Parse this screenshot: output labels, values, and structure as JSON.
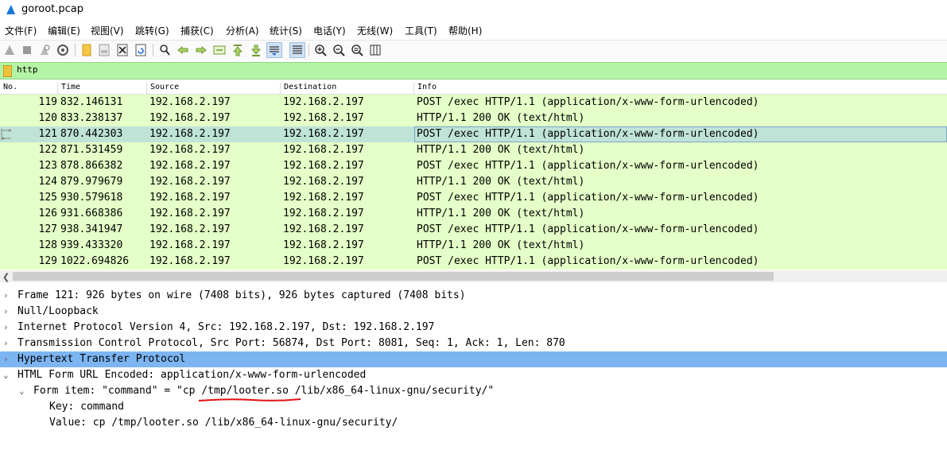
{
  "window": {
    "title": "goroot.pcap"
  },
  "menu": [
    "文件(F)",
    "编辑(E)",
    "视图(V)",
    "跳转(G)",
    "捕获(C)",
    "分析(A)",
    "统计(S)",
    "电话(Y)",
    "无线(W)",
    "工具(T)",
    "帮助(H)"
  ],
  "filter": {
    "value": "http"
  },
  "columns": [
    "No.",
    "Time",
    "Source",
    "Destination",
    "Info"
  ],
  "packets": [
    {
      "no": "119",
      "time": "832.146131",
      "src": "192.168.2.197",
      "dst": "192.168.2.197",
      "info": "POST /exec HTTP/1.1  (application/x-www-form-urlencoded)"
    },
    {
      "no": "120",
      "time": "833.238137",
      "src": "192.168.2.197",
      "dst": "192.168.2.197",
      "info": "HTTP/1.1 200 OK  (text/html)"
    },
    {
      "no": "121",
      "time": "870.442303",
      "src": "192.168.2.197",
      "dst": "192.168.2.197",
      "info": "POST /exec HTTP/1.1  (application/x-www-form-urlencoded)"
    },
    {
      "no": "122",
      "time": "871.531459",
      "src": "192.168.2.197",
      "dst": "192.168.2.197",
      "info": "HTTP/1.1 200 OK  (text/html)"
    },
    {
      "no": "123",
      "time": "878.866382",
      "src": "192.168.2.197",
      "dst": "192.168.2.197",
      "info": "POST /exec HTTP/1.1  (application/x-www-form-urlencoded)"
    },
    {
      "no": "124",
      "time": "879.979679",
      "src": "192.168.2.197",
      "dst": "192.168.2.197",
      "info": "HTTP/1.1 200 OK  (text/html)"
    },
    {
      "no": "125",
      "time": "930.579618",
      "src": "192.168.2.197",
      "dst": "192.168.2.197",
      "info": "POST /exec HTTP/1.1  (application/x-www-form-urlencoded)"
    },
    {
      "no": "126",
      "time": "931.668386",
      "src": "192.168.2.197",
      "dst": "192.168.2.197",
      "info": "HTTP/1.1 200 OK  (text/html)"
    },
    {
      "no": "127",
      "time": "938.341947",
      "src": "192.168.2.197",
      "dst": "192.168.2.197",
      "info": "POST /exec HTTP/1.1  (application/x-www-form-urlencoded)"
    },
    {
      "no": "128",
      "time": "939.433320",
      "src": "192.168.2.197",
      "dst": "192.168.2.197",
      "info": "HTTP/1.1 200 OK  (text/html)"
    },
    {
      "no": "129",
      "time": "1022.694826",
      "src": "192.168.2.197",
      "dst": "192.168.2.197",
      "info": "POST /exec HTTP/1.1  (application/x-www-form-urlencoded)"
    }
  ],
  "selected_packet": "121",
  "details": [
    {
      "text": "Frame 121: 926 bytes on wire (7408 bits), 926 bytes captured (7408 bits)",
      "expander": "collapsed",
      "level": 0
    },
    {
      "text": "Null/Loopback",
      "expander": "collapsed",
      "level": 0
    },
    {
      "text": "Internet Protocol Version 4, Src: 192.168.2.197, Dst: 192.168.2.197",
      "expander": "collapsed",
      "level": 0
    },
    {
      "text": "Transmission Control Protocol, Src Port: 56874, Dst Port: 8081, Seq: 1, Ack: 1, Len: 870",
      "expander": "collapsed",
      "level": 0
    },
    {
      "text": "Hypertext Transfer Protocol",
      "expander": "collapsed",
      "level": 0,
      "highlighted": true
    },
    {
      "text": "HTML Form URL Encoded: application/x-www-form-urlencoded",
      "expander": "expanded",
      "level": 0
    },
    {
      "text": "Form item: \"command\" = \"cp /tmp/looter.so /lib/x86_64-linux-gnu/security/\"",
      "expander": "expanded",
      "level": 1
    },
    {
      "text": "Key: command",
      "expander": "none",
      "level": 2
    },
    {
      "text": "Value: cp /tmp/looter.so /lib/x86_64-linux-gnu/security/",
      "expander": "none",
      "level": 2
    }
  ],
  "colors": {
    "row_bg": "#e4ffc7",
    "selected_row_bg": "#bfe3d6",
    "filter_bg": "#b3f5a4",
    "highlight_bg": "#7db5f2",
    "annotation": "#e01010"
  }
}
